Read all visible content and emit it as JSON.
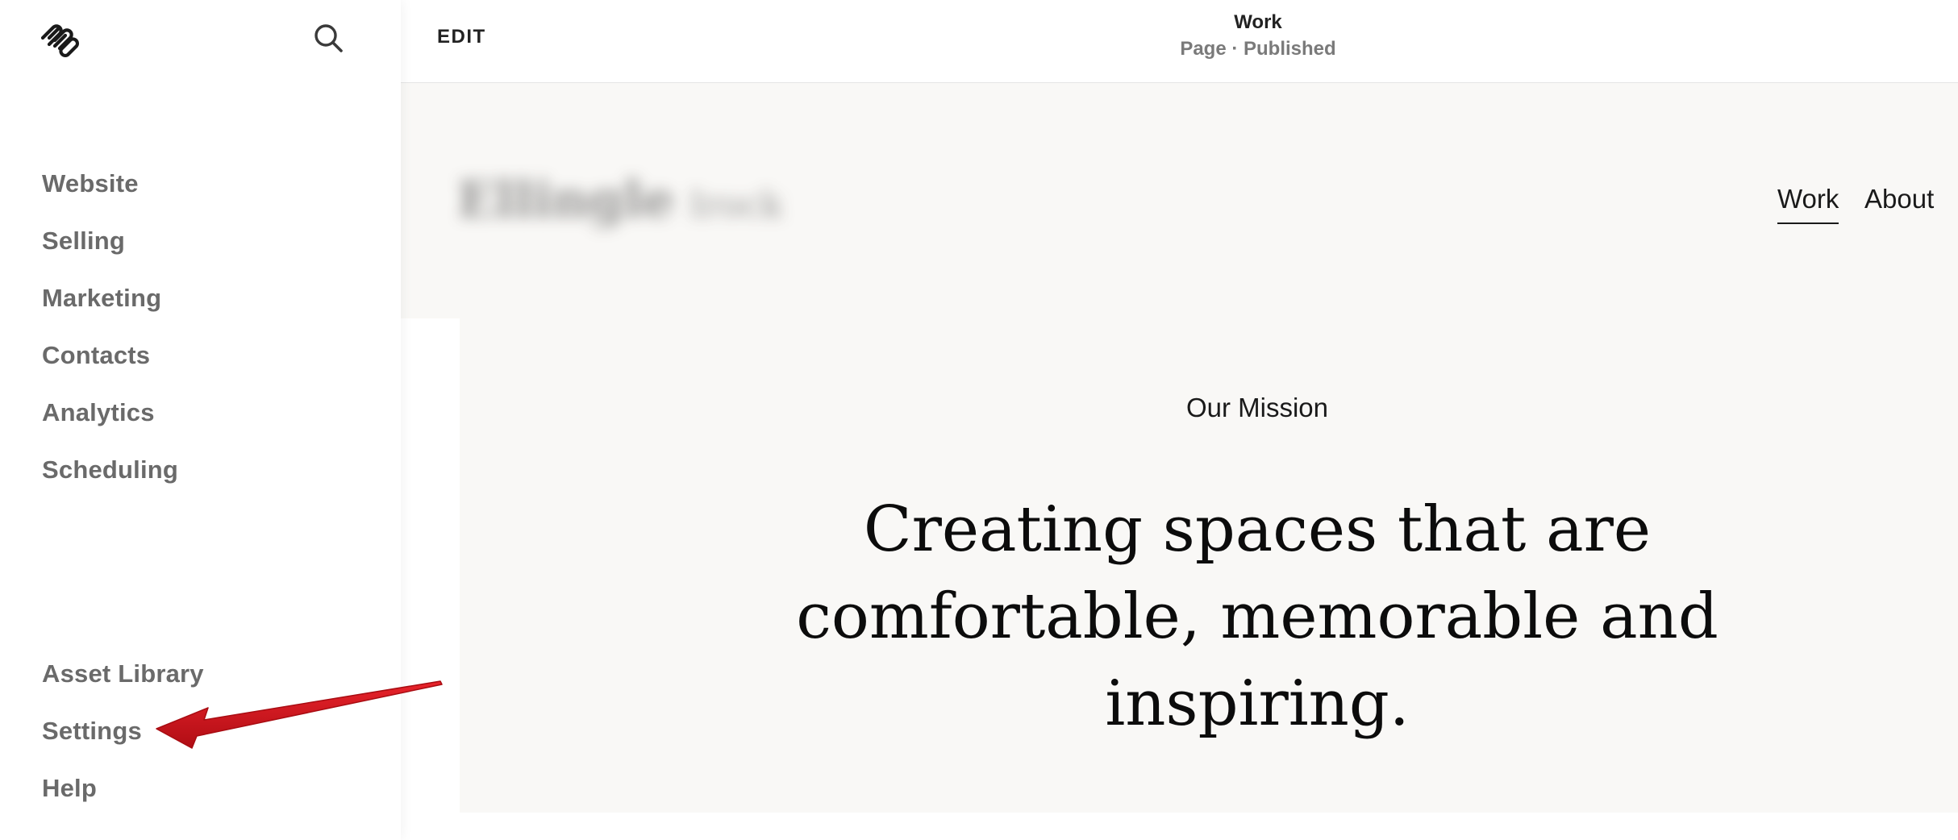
{
  "sidebar": {
    "logo_icon": "squarespace-logo-icon",
    "search_icon": "search-icon",
    "nav_items": [
      {
        "label": "Website"
      },
      {
        "label": "Selling"
      },
      {
        "label": "Marketing"
      },
      {
        "label": "Contacts"
      },
      {
        "label": "Analytics"
      },
      {
        "label": "Scheduling"
      }
    ],
    "bottom_items": [
      {
        "label": "Asset Library"
      },
      {
        "label": "Settings"
      },
      {
        "label": "Help"
      }
    ]
  },
  "topbar": {
    "edit_label": "EDIT",
    "page_title": "Work",
    "page_status": "Page · Published"
  },
  "site": {
    "nav": [
      {
        "label": "Work",
        "active": true
      },
      {
        "label": "About",
        "active": false
      }
    ],
    "mission_label": "Our Mission",
    "headline_lines": [
      "Creating spaces that are",
      "comfortable, memorable and",
      "inspiring."
    ]
  },
  "annotation": {
    "type": "arrow",
    "color": "#d0131c",
    "points_to": "Settings"
  }
}
